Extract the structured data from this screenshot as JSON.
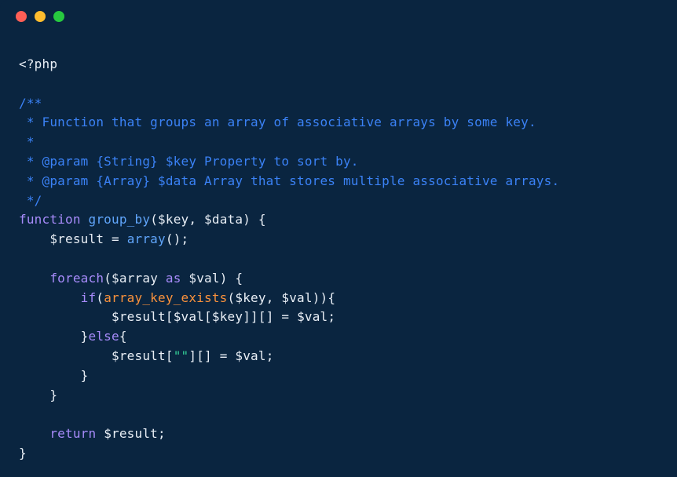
{
  "titlebar": {
    "red": "close",
    "yellow": "minimize",
    "green": "zoom"
  },
  "code": {
    "l1_open": "<?php",
    "l2_blank": "",
    "l3_doc_open": "/**",
    "l4_doc_desc": " * Function that groups an array of associative arrays by some key.",
    "l5_doc_blank": " *",
    "l6_doc_p1": " * @param {String} $key Property to sort by.",
    "l7_doc_p2": " * @param {Array} $data Array that stores multiple associative arrays.",
    "l8_doc_close": " */",
    "l9_fn_kw": "function",
    "l9_fn_name": "group_by",
    "l9_open_paren": "(",
    "l9_arg1": "$key",
    "l9_comma": ", ",
    "l9_arg2": "$data",
    "l9_close_paren": ")",
    "l9_space_brace": " {",
    "l10_indent": "    ",
    "l10_var": "$result",
    "l10_eq": " = ",
    "l10_array": "array",
    "l10_call": "();",
    "l11_blank": "",
    "l12_indent": "    ",
    "l12_foreach": "foreach",
    "l12_open": "(",
    "l12_arr": "$array",
    "l12_as_sp1": " ",
    "l12_as": "as",
    "l12_as_sp2": " ",
    "l12_val": "$val",
    "l12_close": ") {",
    "l13_indent": "        ",
    "l13_if": "if",
    "l13_open": "(",
    "l13_fn": "array_key_exists",
    "l13_open2": "(",
    "l13_a1": "$key",
    "l13_comma": ", ",
    "l13_a2": "$val",
    "l13_close": ")){",
    "l14_indent": "            ",
    "l14_res": "$result",
    "l14_b1": "[",
    "l14_val": "$val",
    "l14_b2": "[",
    "l14_key": "$key",
    "l14_b3": "]][] = ",
    "l14_rhs": "$val",
    "l14_semi": ";",
    "l15_indent": "        }",
    "l15_else": "else",
    "l15_brace": "{",
    "l16_indent": "            ",
    "l16_res": "$result",
    "l16_b1": "[",
    "l16_str": "\"\"",
    "l16_b2": "][] = ",
    "l16_rhs": "$val",
    "l16_semi": ";",
    "l17_indent": "        }",
    "l18_indent": "    }",
    "l19_blank": "",
    "l20_indent": "    ",
    "l20_return": "return",
    "l20_sp": " ",
    "l20_var": "$result",
    "l20_semi": ";",
    "l21_close": "}"
  }
}
